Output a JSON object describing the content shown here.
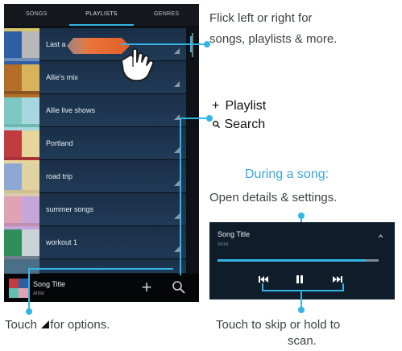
{
  "tabs": [
    {
      "label": "SONGS"
    },
    {
      "label": "PLAYLISTS",
      "active": true
    },
    {
      "label": "GENRES"
    }
  ],
  "playlists": [
    {
      "label": "Last a",
      "colors": [
        "#2e5ea3",
        "#b8b8b8"
      ]
    },
    {
      "label": "Allie's mix",
      "colors": [
        "#b46e27",
        "#d8b35c"
      ]
    },
    {
      "label": "Allie live shows",
      "colors": [
        "#7dc8c0",
        "#a7d7df"
      ]
    },
    {
      "label": "Portland",
      "colors": [
        "#c03c3f",
        "#e8d59c"
      ]
    },
    {
      "label": "road trip",
      "colors": [
        "#8da8d4",
        "#e0d2a1"
      ]
    },
    {
      "label": "summer songs",
      "colors": [
        "#e1a2b6",
        "#c5a6da"
      ]
    },
    {
      "label": "workout 1",
      "colors": [
        "#2f8d5a",
        "#c9d2d7"
      ]
    }
  ],
  "now_playing": {
    "title": "Song Title",
    "artist": "Artist",
    "art_colors": [
      "#c03c3f",
      "#2e5ea3",
      "#5fc0b2",
      "#e1a2b6"
    ]
  },
  "callouts": {
    "flick": [
      "Flick left or right for",
      "songs, playlists & more."
    ],
    "add_playlist": "Playlist",
    "search": "Search",
    "during_song": "During a song:",
    "open_details": "Open details & settings.",
    "options": [
      "Touch ",
      "for options."
    ],
    "skip": [
      "Touch to skip or hold to",
      "scan."
    ]
  },
  "panel": {
    "title": "Song Title",
    "artist": "Artist",
    "progress": 0.92
  },
  "colors": {
    "accent": "#33b5e5",
    "drag_pill": "#e8753b"
  }
}
